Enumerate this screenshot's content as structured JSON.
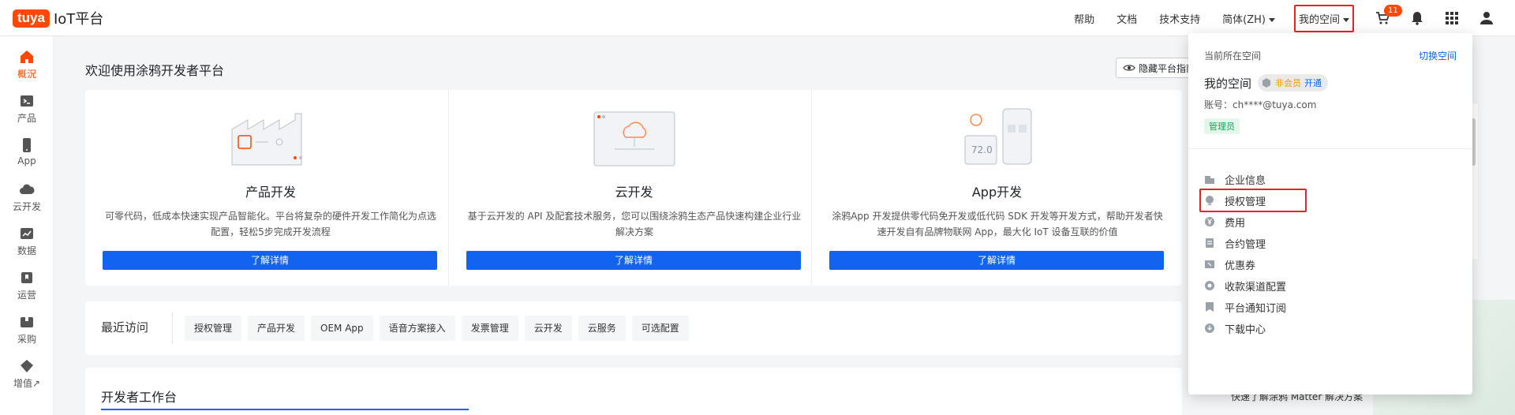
{
  "brand": {
    "logo": "tuya",
    "product": "IoT平台",
    "accent": "#ff4800"
  },
  "topnav": {
    "help": "帮助",
    "docs": "文档",
    "support": "技术支持",
    "language": "简体(ZH)",
    "my_space": "我的空间",
    "cart_count": "11"
  },
  "sidebar": {
    "items": [
      {
        "label": "概況",
        "icon": "home-icon"
      },
      {
        "label": "产品",
        "icon": "terminal-icon"
      },
      {
        "label": "App",
        "icon": "phone-icon"
      },
      {
        "label": "云开发",
        "icon": "cloud-icon"
      },
      {
        "label": "数据",
        "icon": "chart-icon"
      },
      {
        "label": "运营",
        "icon": "bookmark-icon"
      },
      {
        "label": "采购",
        "icon": "box-icon"
      },
      {
        "label": "增值↗",
        "icon": "diamond-icon"
      }
    ]
  },
  "main": {
    "welcome": "欢迎使用涂鸦开发者平台",
    "hide_guide": "隐藏平台指南",
    "cards": [
      {
        "title": "产品开发",
        "desc": "可零代码，低成本快速实现产品智能化。平台将复杂的硬件开发工作简化为点选配置，轻松5步完成开发流程",
        "button": "了解详情"
      },
      {
        "title": "云开发",
        "desc": "基于云开发的 API 及配套技术服务，您可以围绕涂鸦生态产品快速构建企业行业解决方案",
        "button": "了解详情"
      },
      {
        "title": "App开发",
        "desc": "涂鸦App 开发提供零代码免开发或低代码 SDK 开发等开发方式，帮助开发者快速开发自有品牌物联网 App，最大化 IoT 设备互联的价值",
        "button": "了解详情"
      }
    ],
    "recent_label": "最近访问",
    "recent_tags": [
      "授权管理",
      "产品开发",
      "OEM App",
      "语音方案接入",
      "发票管理",
      "云开发",
      "云服务",
      "可选配置"
    ],
    "workbench_title": "开发者工作台",
    "banner_text": "快速了解涂鸦 Matter 解决方案"
  },
  "dropdown": {
    "current_space_label": "当前所在空间",
    "switch_space": "切换空间",
    "space_name": "我的空间",
    "non_member": "非会员",
    "open": "开通",
    "account": "账号：ch****@tuya.com",
    "role": "管理员",
    "menu": [
      {
        "label": "企业信息",
        "icon": "building-icon"
      },
      {
        "label": "授权管理",
        "icon": "authorization-icon"
      },
      {
        "label": "费用",
        "icon": "yen-icon"
      },
      {
        "label": "合约管理",
        "icon": "contract-icon"
      },
      {
        "label": "优惠券",
        "icon": "coupon-icon"
      },
      {
        "label": "收款渠道配置",
        "icon": "payment-icon"
      },
      {
        "label": "平台通知订阅",
        "icon": "notification-icon"
      },
      {
        "label": "下载中心",
        "icon": "download-icon"
      }
    ]
  }
}
